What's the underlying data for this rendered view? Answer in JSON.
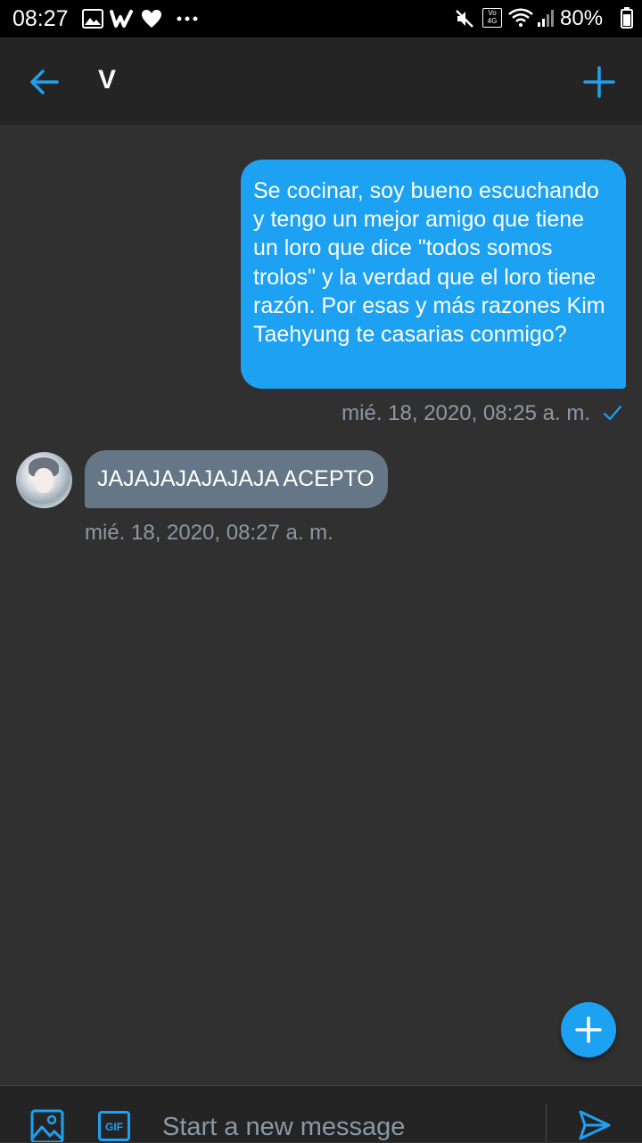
{
  "status_bar": {
    "time": "08:27",
    "battery": "80%",
    "network": "4G",
    "volte": "Vo"
  },
  "header": {
    "title": "V",
    "back_icon": "arrow-left-icon",
    "action_icon": "plus-icon"
  },
  "messages": [
    {
      "direction": "outgoing",
      "text": "Se cocinar, soy bueno escuchando y tengo un mejor amigo que tiene un loro que dice \"todos somos trolos\" y la verdad que el loro tiene razón. Por esas y más razones Kim Taehyung te casarias conmigo?",
      "timestamp": "mié. 18, 2020, 08:25 a. m.",
      "status_icon": "checkmark-icon"
    },
    {
      "direction": "incoming",
      "text": "JAJAJAJAJAJAJA ACEPTO",
      "timestamp": "mié. 18, 2020, 08:27 a. m."
    }
  ],
  "fab": {
    "icon": "plus-icon"
  },
  "composer": {
    "placeholder": "Start a new message",
    "gif_label": "GIF",
    "image_icon": "image-icon",
    "send_icon": "send-icon"
  },
  "colors": {
    "accent": "#1da1f2",
    "background": "#303030",
    "bar": "#242424",
    "incoming_bubble": "#657786",
    "muted_text": "#8b98a5"
  }
}
